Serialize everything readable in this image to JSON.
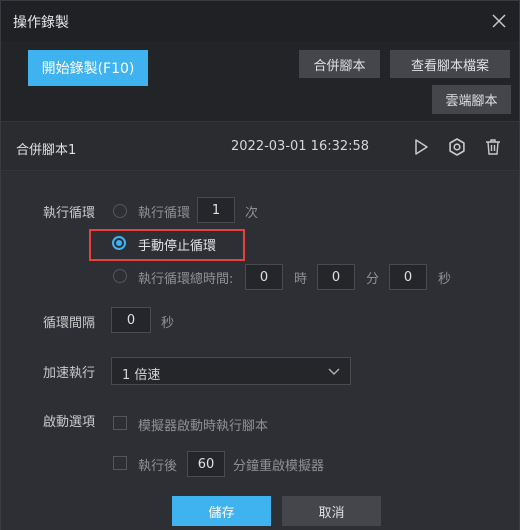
{
  "window": {
    "title": "操作錄製"
  },
  "toolbar": {
    "record_button": "開始錄製(F10)",
    "merge_button": "合併腳本",
    "view_files_button": "查看腳本檔案",
    "cloud_button": "雲端腳本"
  },
  "script": {
    "name": "合併腳本1",
    "datetime": "2022-03-01 16:32:58"
  },
  "loop": {
    "label": "執行循環",
    "option_count_label": "執行循環",
    "count_value": "1",
    "count_unit": "次",
    "option_manual_label": "手動停止循環",
    "option_total_time_label": "執行循環總時間:",
    "hours_value": "0",
    "hours_unit": "時",
    "minutes_value": "0",
    "minutes_unit": "分",
    "seconds_value": "0",
    "seconds_unit": "秒"
  },
  "interval": {
    "label": "循環間隔",
    "value": "0",
    "unit": "秒"
  },
  "speed": {
    "label": "加速執行",
    "selected": "1 倍速"
  },
  "startup": {
    "label": "啟動選項",
    "run_on_start_label": "模擬器啟動時執行腳本",
    "restart_prefix": "執行後",
    "restart_value": "60",
    "restart_suffix": "分鐘重啟模擬器"
  },
  "footer": {
    "save_button": "儲存",
    "cancel_button": "取消"
  },
  "colors": {
    "accent": "#3fb2f0",
    "highlight_box": "#e8403a",
    "background": "#2b2c30"
  }
}
